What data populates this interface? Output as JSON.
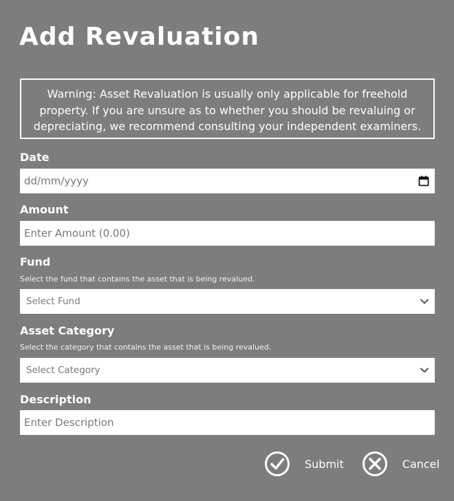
{
  "dialog": {
    "title": "Add Revaluation",
    "warning": "Warning: Asset Revaluation is usually only applicable for freehold property. If you are unsure as to whether you should be revaluing or depreciating, we recommend consulting your independent examiners."
  },
  "fields": {
    "date": {
      "label": "Date",
      "placeholder": "dd/mm/yyyy",
      "icon": "calendar-icon"
    },
    "amount": {
      "label": "Amount",
      "placeholder": "Enter Amount (0.00)"
    },
    "fund": {
      "label": "Fund",
      "help": "Select the fund that contains the asset that is being revalued.",
      "selected": "Select Fund",
      "icon": "chevron-down-icon"
    },
    "category": {
      "label": "Asset Category",
      "help": "Select the category that contains the asset that is being revalued.",
      "selected": "Select Category",
      "icon": "chevron-down-icon"
    },
    "description": {
      "label": "Description",
      "placeholder": "Enter Description"
    }
  },
  "actions": {
    "submit": {
      "label": "Submit",
      "icon": "checkmark-circle-icon"
    },
    "cancel": {
      "label": "Cancel",
      "icon": "x-circle-icon"
    }
  },
  "colors": {
    "background": "#7d7d7d",
    "text": "#ffffff",
    "field_background": "#ffffff",
    "placeholder": "#777777"
  }
}
